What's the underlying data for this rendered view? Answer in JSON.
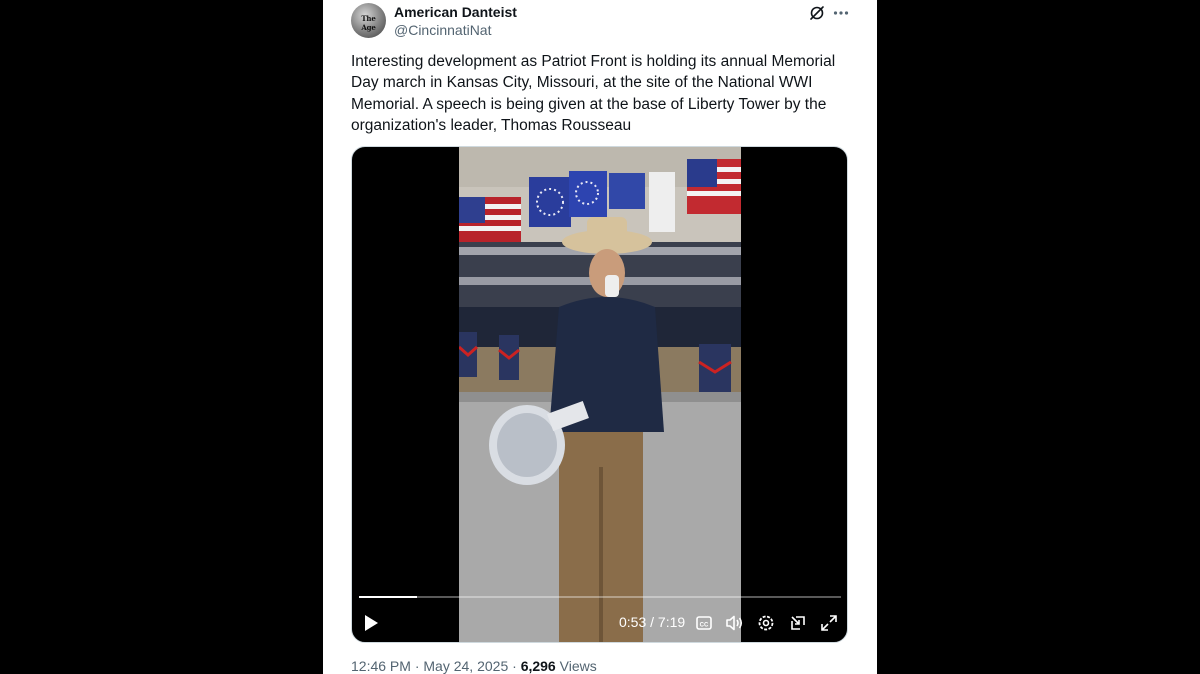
{
  "tweet": {
    "display_name": "American Danteist",
    "handle": "@CincinnatiNat",
    "avatar_text": "The Age",
    "text": "Interesting development as Patriot Front is holding its annual Memorial Day march in Kansas City, Missouri, at the site of the National WWI Memorial. A speech is being given at the base of Liberty Tower by the organization's leader, Thomas Rousseau",
    "icons": [
      "grok-icon",
      "more-icon"
    ]
  },
  "video": {
    "current_time": "0:53",
    "separator": " / ",
    "duration": "7:19",
    "progress_fraction": 0.121,
    "controls": [
      "play-icon",
      "captions-icon",
      "volume-icon",
      "settings-icon",
      "popout-icon",
      "fullscreen-icon"
    ]
  },
  "footer": {
    "time": "12:46 PM",
    "dot1": " · ",
    "date": "May 24, 2025",
    "dot2": " · ",
    "views_count": "6,296",
    "views_label": " Views"
  },
  "colors": {
    "text_primary": "#0f1419",
    "text_secondary": "#536471",
    "background": "#000000",
    "card": "#ffffff"
  }
}
